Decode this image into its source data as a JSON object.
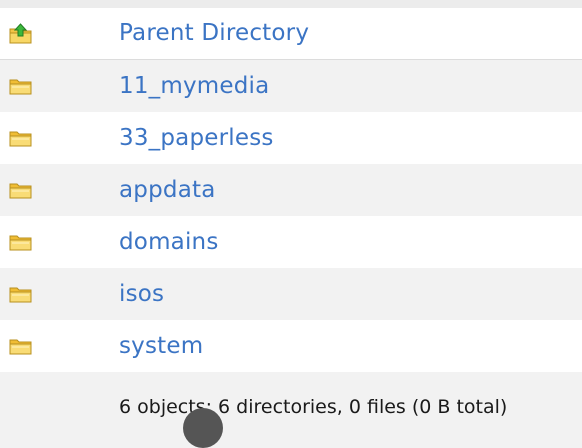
{
  "listing": {
    "items": [
      {
        "label": "Parent Directory",
        "icon": "parent-directory-icon"
      },
      {
        "label": "11_mymedia",
        "icon": "folder-icon"
      },
      {
        "label": "33_paperless",
        "icon": "folder-icon"
      },
      {
        "label": "appdata",
        "icon": "folder-icon"
      },
      {
        "label": "domains",
        "icon": "folder-icon"
      },
      {
        "label": "isos",
        "icon": "folder-icon"
      },
      {
        "label": "system",
        "icon": "folder-icon"
      }
    ],
    "summary": "6 objects: 6 directories, 0 files (0 B total)"
  },
  "colors": {
    "link": "#3b74c4",
    "folder": "#f3c545",
    "arrow": "#3db83d"
  }
}
